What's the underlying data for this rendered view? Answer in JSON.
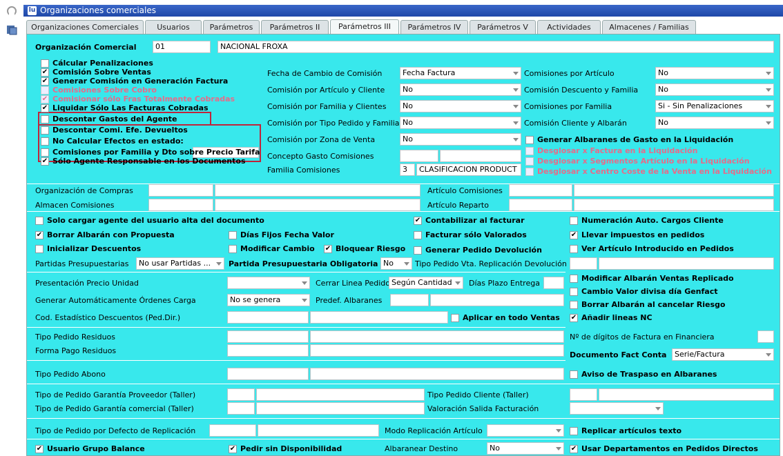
{
  "window": {
    "title": "Organizaciones comerciales"
  },
  "tabs": [
    "Organizaciones Comerciales",
    "Usuarios",
    "Parámetros",
    "Parámetros II",
    "Parámetros III",
    "Parámetros IV",
    "Parámetros V",
    "Actividades",
    "Almacenes / Familias"
  ],
  "org": {
    "label": "Organización Comercial",
    "code": "01",
    "name": "NACIONAL FROXA"
  },
  "left_checks": [
    {
      "label": "Cálcular Penalizaciones",
      "checked": false,
      "disabled": false
    },
    {
      "label": "Comisión Sobre Ventas",
      "checked": true,
      "disabled": false
    },
    {
      "label": "Generar Comisión en Generación Factura",
      "checked": true,
      "disabled": false
    },
    {
      "label": "Comisiones Sobre Cobro",
      "checked": false,
      "disabled": true
    },
    {
      "label": "Comisionar sólo Fras Totalmente Cobradas",
      "checked": true,
      "disabled": true
    },
    {
      "label": "Liquidar Sólo Las Facturas Cobradas",
      "checked": true,
      "disabled": false
    },
    {
      "label": "Descontar Gastos del Agente",
      "checked": false,
      "disabled": false
    },
    {
      "label": "Descontar Comi. Efe. Devueltos",
      "checked": false,
      "disabled": false
    },
    {
      "label": "No Calcular Efectos en estado:",
      "checked": false,
      "disabled": false
    },
    {
      "label": "Comisiones por Familia y Dto sobre Precio Tarifa",
      "checked": false,
      "disabled": false
    },
    {
      "label": "Sólo Agente Responsable en los Documentos",
      "checked": true,
      "disabled": false
    }
  ],
  "mid": {
    "fecha_cambio": {
      "label": "Fecha de Cambio de Comisión",
      "value": "Fecha Factura"
    },
    "com_art_cli": {
      "label": "Comisión por Artículo y Cliente",
      "value": "No"
    },
    "com_fam_cli": {
      "label": "Comisión por Familia y Clientes",
      "value": "No"
    },
    "com_tipo_ped": {
      "label": "Comisión por Tipo Pedido y Familia",
      "value": "No"
    },
    "com_zona": {
      "label": "Comisión por Zona de Venta",
      "value": "No"
    },
    "concepto_gasto": {
      "label": "Concepto Gasto Comisiones"
    },
    "familia_com": {
      "label": "Familia Comisiones",
      "code": "3",
      "value": "CLASIFICACION PRODUCT"
    }
  },
  "right": {
    "com_articulo": {
      "label": "Comisiones por Artículo",
      "value": "No"
    },
    "com_desc_fam": {
      "label": "Comisión Descuento y Familia",
      "value": "No"
    },
    "com_familia": {
      "label": "Comisiones por Familia",
      "value": "Si - Sin Penalizaciones"
    },
    "com_cli_alb": {
      "label": "Comisión Cliente y Albarán",
      "value": "No"
    },
    "gen_alb": {
      "label": "Generar Albaranes de Gasto en la Liquidación",
      "checked": false
    },
    "disabled_checks": [
      "Desglosar x Factura en la Liquidación",
      "Desglosar x Segmentos Artículo en la Liquidación",
      "Desglosar x Centro Coste de la Venta en la Liquidación"
    ]
  },
  "rows": {
    "org_compras": "Organización de Compras",
    "art_comisiones": "Artículo Comisiones",
    "almacen_com": "Almacen Comisiones",
    "art_reparto": "Artículo Reparto"
  },
  "checks2": {
    "solo_cargar": {
      "label": "Solo cargar agente del usuario alta del documento",
      "checked": false
    },
    "contabilizar": {
      "label": "Contabilizar al facturar",
      "checked": true
    },
    "numeracion": {
      "label": "Numeración Auto. Cargos Cliente",
      "checked": false
    },
    "borrar_alb": {
      "label": "Borrar Albarán con Propuesta",
      "checked": true
    },
    "dias_fijos": {
      "label": "Días Fijos Fecha Valor",
      "checked": false
    },
    "facturar_val": {
      "label": "Facturar sólo Valorados",
      "checked": false
    },
    "llevar_imp": {
      "label": "Llevar impuestos en pedidos",
      "checked": true
    },
    "inic_desc": {
      "label": "Inicializar Descuentos",
      "checked": false
    },
    "mod_cambio": {
      "label": "Modificar Cambio",
      "checked": false
    },
    "bloq_riesgo": {
      "label": "Bloquear Riesgo",
      "checked": true
    },
    "gen_ped_dev": {
      "label": "Generar Pedido Devolución",
      "checked": false
    },
    "ver_art": {
      "label": "Ver Artículo Introducido en Pedidos",
      "checked": false
    }
  },
  "partidas": {
    "label": "Partidas Presupuestarias",
    "value": "No usar Partidas ...",
    "oblig_label": "Partida Presupuestaria Obligatoria",
    "oblig_value": "No",
    "tipo_repl_label": "Tipo Pedido Vta. Replicación Devolución"
  },
  "form": {
    "pres_precio": "Presentación Precio Unidad",
    "cerrar_linea": {
      "label": "Cerrar Linea Pedido",
      "value": "Según Cantidad"
    },
    "dias_plazo": "Días Plazo Entrega",
    "gen_auto": {
      "label": "Generar Automáticamente Órdenes Carga",
      "value": "No se genera"
    },
    "predef_alb": "Predef. Albaranes",
    "cod_est": "Cod. Estadístico Descuentos (Ped.Dir.)",
    "aplicar": {
      "label": "Aplicar en todo Ventas",
      "checked": false
    },
    "tipo_residuos": "Tipo Pedido Residuos",
    "forma_pago": "Forma Pago Residuos",
    "tipo_abono": "Tipo Pedido Abono",
    "garantia_prov": "Tipo de Pedido Garantía Proveedor (Taller)",
    "garantia_com": "Tipo de Pedido Garantía comercial (Taller)",
    "tipo_cli_taller": "Tipo Pedido Cliente (Taller)",
    "valoracion": "Valoración Salida Facturación",
    "defecto_repl": "Tipo de Pedido por Defecto de Replicación",
    "modo_repl": "Modo Replicación Artículo",
    "alb_destino": {
      "label": "Albaranear Destino",
      "value": "No"
    }
  },
  "right2": {
    "mod_alb": {
      "label": "Modificar Albarán Ventas Replicado",
      "checked": false
    },
    "cambio_valor": {
      "label": "Cambio Valor divisa día Genfact",
      "checked": false
    },
    "borrar_riesgo": {
      "label": "Borrar Albarán al cancelar Riesgo",
      "checked": false
    },
    "anadir_nc": {
      "label": "Añadir lineas NC",
      "checked": true
    },
    "digitos": "Nº de dígitos de Factura en Financiera",
    "doc_fact": {
      "label": "Documento Fact Conta",
      "value": "Serie/Factura"
    },
    "aviso": {
      "label": "Aviso de Traspaso en Albaranes",
      "checked": false
    },
    "replicar": {
      "label": "Replicar artículos texto",
      "checked": false
    }
  },
  "bottom": {
    "usuario_grupo": {
      "label": "Usuario Grupo Balance",
      "checked": true
    },
    "pedir_sin": {
      "label": "Pedir sin Disponibilidad",
      "checked": true
    },
    "usar_dep": {
      "label": "Usar Departamentos en Pedidos Directos",
      "checked": true
    }
  },
  "check_mark": "✔",
  "colors": {
    "panel": "#38e8ec",
    "title": "#1f47a8",
    "disabled_text": "#e56d8a",
    "highlight": "#c0233a"
  }
}
